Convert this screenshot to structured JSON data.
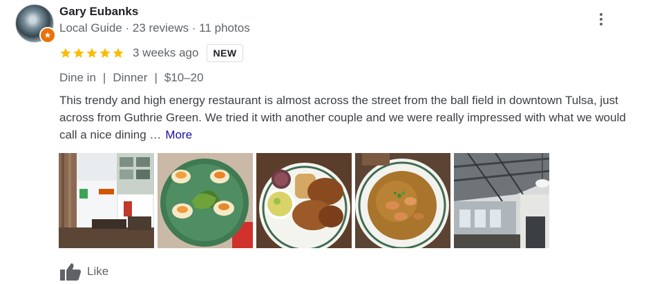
{
  "reviewer": {
    "name": "Gary Eubanks",
    "role": "Local Guide",
    "reviews": "23 reviews",
    "photos": "11 photos",
    "separator": "·",
    "badge_icon": "local-guide-star-icon"
  },
  "menu_icon": "more-vert-icon",
  "rating": {
    "stars": 5,
    "max": 5,
    "star_color": "#fbbc04"
  },
  "time_ago": "3 weeks ago",
  "badge": "NEW",
  "meta": {
    "service": "Dine in",
    "meal": "Dinner",
    "price": "$10–20",
    "separator": "|"
  },
  "review_text": "This trendy and high energy restaurant is almost across the street from the ball field in downtown Tulsa, just across from Guthrie Green.  We tried it with another couple and we were really impressed with what we would call a nice dining …",
  "more_label": "More",
  "photos": [
    {
      "subject": "restaurant-interior"
    },
    {
      "subject": "deviled-eggs-plate"
    },
    {
      "subject": "fried-chicken-plate"
    },
    {
      "subject": "gumbo-bowl"
    },
    {
      "subject": "restaurant-ceiling"
    }
  ],
  "actions": {
    "like_label": "Like",
    "like_icon": "thumbs-up-icon"
  },
  "colors": {
    "link": "#1a0dab",
    "secondary_text": "#5f6368",
    "badge_orange": "#e8710a"
  }
}
